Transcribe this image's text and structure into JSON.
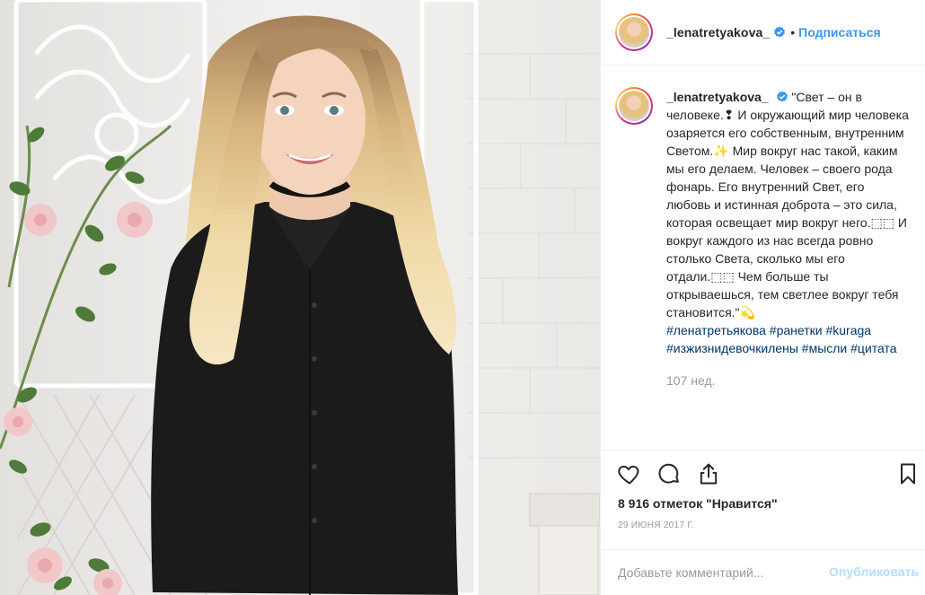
{
  "post": {
    "username": "_lenatretyakova_",
    "follow_label": "Подписаться",
    "dot": "•",
    "caption": {
      "username": "_lenatretyakova_",
      "text": "\"Свет – он в человеке.❢ И окружающий мир человека озаряется его собственным, внутренним Светом.✨ Мир вокруг нас такой, каким мы его делаем. Человек – своего рода фонарь. Его внутренний Свет, его любовь и истинная доброта – это сила, которая освещает мир вокруг него.⬚⬚ И вокруг каждого из нас всегда ровно столько Света, сколько мы его отдали.⬚⬚ Чем больше ты открываешься, тем светлее вокруг тебя становится.\"💫",
      "hashtags": [
        "#ленатретьякова",
        "#ранетки",
        "#kuraga",
        "#изжизнидевочкилены",
        "#мысли",
        "#цитата"
      ],
      "age": "107 нед."
    },
    "likes": "8 916 отметок \"Нравится\"",
    "date": "29 ИЮНЯ 2017 Г.",
    "comment": {
      "placeholder": "Добавьте комментарий...",
      "value": "",
      "publish_label": "Опубликовать"
    },
    "icons": [
      "heart-icon",
      "comment-icon",
      "share-icon",
      "bookmark-icon",
      "verified-badge-icon"
    ],
    "colors": {
      "accent": "#3897f0",
      "hashtag": "#003569",
      "muted": "#999999",
      "publish_disabled": "#b2dffc",
      "verified": "#3897f0"
    }
  }
}
